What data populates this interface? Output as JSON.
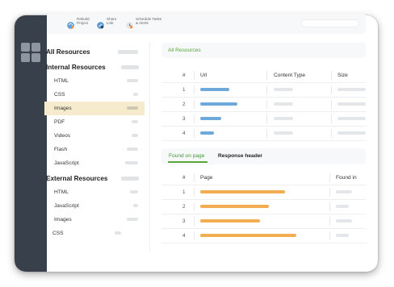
{
  "toolbar": {
    "rebuild_line1": "Rebuild",
    "rebuild_line2": "Project",
    "share_line1": "Share",
    "share_line2": "Link",
    "schedule_line1": "Schedule Tasks",
    "schedule_line2": "& Alerts"
  },
  "sidebar": {
    "all_resources": "All Resources",
    "internal_resources": "Internal Resources",
    "internal_items": [
      "HTML",
      "CSS",
      "Images",
      "PDF",
      "Videos",
      "Flash",
      "JavaScript"
    ],
    "external_resources": "External Resources",
    "external_items": [
      "HTML",
      "JavaScript",
      "Images",
      "CSS"
    ]
  },
  "resources_panel": {
    "title": "All Resources",
    "columns": [
      "#",
      "Url",
      "Content Type",
      "Size"
    ],
    "rows": [
      "1",
      "2",
      "3",
      "4"
    ],
    "url_bar_fraction": [
      0.4,
      0.51,
      0.29,
      0.19
    ]
  },
  "pages_panel": {
    "tab_active": "Found on page",
    "tab_inactive": "Response header",
    "columns": [
      "#",
      "Page",
      "Found in"
    ],
    "rows": [
      "1",
      "2",
      "3",
      "4"
    ],
    "page_bar_fraction": [
      0.7,
      0.57,
      0.49,
      0.79
    ]
  },
  "colors": {
    "rail": "#38404b",
    "accent_green": "#59a83a",
    "selected_bg": "#f6eccd",
    "url_bar": "#6ea9dc",
    "page_bar": "#f2ad51"
  },
  "icons": {
    "rebuild": "refresh-icon",
    "share": "share-link-icon",
    "schedule": "schedule-alert-icon",
    "logo": "app-logo-icon"
  }
}
